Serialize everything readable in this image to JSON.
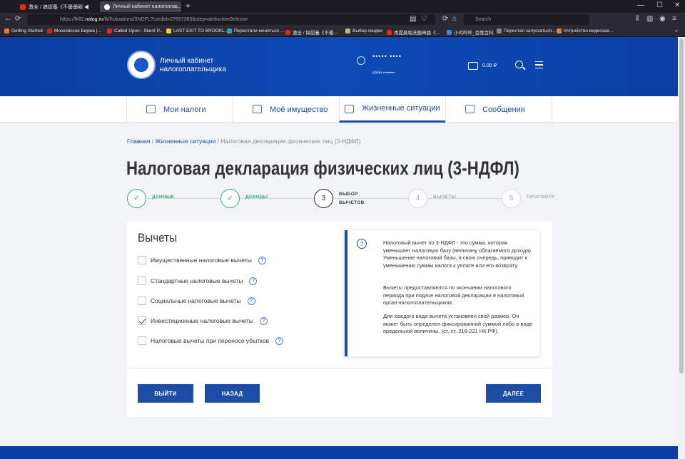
{
  "browser": {
    "tabs": [
      {
        "title": "激全 / 搞認養《不優優剧 ◀"
      },
      {
        "title": "Личный кабинет налогопла..."
      }
    ],
    "url_prefix": "https://lkfl2.",
    "url_domain": "nalog.ru",
    "url_rest": "/lkfl/situations/3NDFL?cardId=27687385&step=deductionSelector",
    "search_placeholder": "Search",
    "bookmarks": [
      "Getting Started",
      "Московская Биржа |...",
      "Called Upon - Silent P...",
      "LAST EXIT TO BROOKL...",
      "Перестали меняться ...",
      "激全 / 搞認養《不優...",
      "Выбор скидки",
      "再提晨唱洗腦神曲《...",
      "小鸡哔哔_百度百科",
      "Перестал запускаться...",
      "Устройство видеозах..."
    ]
  },
  "header": {
    "site_title": "Личный кабинет налогоплательщика",
    "user_name": "••••• ••••",
    "inn": "ИНН ••••••••",
    "balance": "0.00 ₽"
  },
  "nav": {
    "items": [
      {
        "label": "Мои налоги"
      },
      {
        "label": "Моё имущество"
      },
      {
        "label": "Жизненные ситуации"
      },
      {
        "label": "Сообщения"
      }
    ]
  },
  "breadcrumb": {
    "home": "Главная",
    "sep": " / ",
    "section": "Жизненные ситуации",
    "current": "Налоговая декларация физических лиц (3-НДФЛ)"
  },
  "page_title": "Налоговая декларация физических лиц (3-НДФЛ)",
  "stepper": [
    {
      "num": "✓",
      "label": "ДАННЫЕ"
    },
    {
      "num": "✓",
      "label": "ДОХОДЫ"
    },
    {
      "num": "3",
      "label": "ВЫБОР ВЫЧЕТОВ"
    },
    {
      "num": "4",
      "label": "ВЫЧЕТЫ"
    },
    {
      "num": "5",
      "label": "ПРОСМОТР"
    }
  ],
  "deductions": {
    "title": "Вычеты",
    "options": [
      {
        "label": "Имущественные налоговые вычеты",
        "checked": false
      },
      {
        "label": "Стандартные налоговые вычеты",
        "checked": false
      },
      {
        "label": "Социальные налоговые вычеты",
        "checked": false
      },
      {
        "label": "Инвестиционные налоговые вычеты",
        "checked": true
      },
      {
        "label": "Налоговые вычеты при переносе убытков",
        "checked": false
      }
    ],
    "help_glyph": "?"
  },
  "info": {
    "p1": "Налоговый вычет по 3-НДФЛ - это сумма, которая уменьшает налоговую базу (величину облагаемого дохода). Уменьшение налоговой базы, в свою очередь, приводит к уменьшению суммы налога к уплате или его возврату.",
    "p2": "Вычеты предоставляются по окончании налогового периода при подаче налоговой декларации в налоговый орган налогоплательщиком.",
    "p3": "Для каждого вида вычета установлен свой размер. Он может быть определен фиксированной суммой либо в виде предельной величины. (ст. ст. 218-221 НК РФ)."
  },
  "buttons": {
    "exit": "ВЫЙТИ",
    "back": "НАЗАД",
    "next": "ДАЛЕЕ"
  }
}
